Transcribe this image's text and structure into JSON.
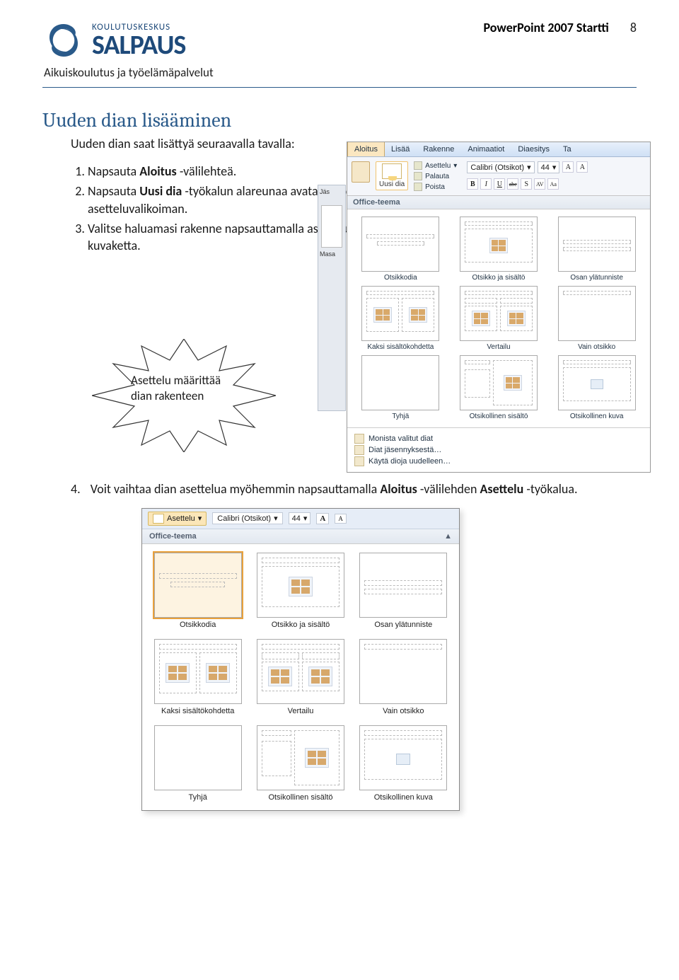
{
  "header": {
    "logo_super": "KOULUTUSKESKUS",
    "logo_main": "SALPAUS",
    "doc_title": "PowerPoint 2007 Startti",
    "page_number": "8",
    "sub": "Aikuiskoulutus ja työelämäpalvelut"
  },
  "section_title": "Uuden dian lisääminen",
  "intro": "Uuden dian saat lisättyä seuraavalla tavalla:",
  "steps": {
    "s1a": "Napsauta ",
    "s1b": "Aloitus",
    "s1c": " -välilehteä.",
    "s2a": "Napsauta ",
    "s2b": "Uusi dia",
    "s2c": " -työkalun alareunaa avataksesi dia-asetteluvalikoiman.",
    "s3": "Valitse haluamasi rakenne napsauttamalla asettelun kuvaketta."
  },
  "starburst": {
    "line1": "Asettelu määrittää",
    "line2": "dian rakenteen"
  },
  "step4": {
    "num": "4.",
    "a": "Voit vaihtaa dian asettelua myöhemmin napsauttamalla ",
    "b": "Aloitus",
    "c": " -välilehden ",
    "d": "Asettelu",
    "e": " -työkalua."
  },
  "shot1": {
    "tabs": [
      "Aloitus",
      "Lisää",
      "Rakenne",
      "Animaatiot",
      "Diaesitys",
      "Ta"
    ],
    "ribbon": {
      "newslide": "Uusi dia",
      "asettelu": "Asettelu",
      "palauta": "Palauta",
      "poista": "Poista",
      "font": "Calibri (Otsikot)",
      "size": "44",
      "fmt_b": "B",
      "fmt_i": "I",
      "fmt_u": "U",
      "fmt_abc": "abc",
      "fmt_s": "S",
      "fmt_av": "AV",
      "fmt_aa": "Aa"
    },
    "office": "Office-teema",
    "side": [
      "Jäs",
      "Masa"
    ],
    "layouts": [
      "Otsikkodia",
      "Otsikko ja sisältö",
      "Osan ylätunniste",
      "Kaksi sisältökohdetta",
      "Vertailu",
      "Vain otsikko",
      "Tyhjä",
      "Otsikollinen sisältö",
      "Otsikollinen kuva"
    ],
    "bottom": [
      "Monista valitut diat",
      "Diat jäsennyksestä…",
      "Käytä dioja uudelleen…"
    ]
  },
  "shot2": {
    "asettelu": "Asettelu",
    "font": "Calibri (Otsikot)",
    "size": "44",
    "a_up": "A",
    "a_dn": "A",
    "office": "Office-teema",
    "layouts": [
      "Otsikkodia",
      "Otsikko ja sisältö",
      "Osan ylätunniste",
      "Kaksi sisältökohdetta",
      "Vertailu",
      "Vain otsikko",
      "Tyhjä",
      "Otsikollinen sisältö",
      "Otsikollinen kuva"
    ]
  }
}
